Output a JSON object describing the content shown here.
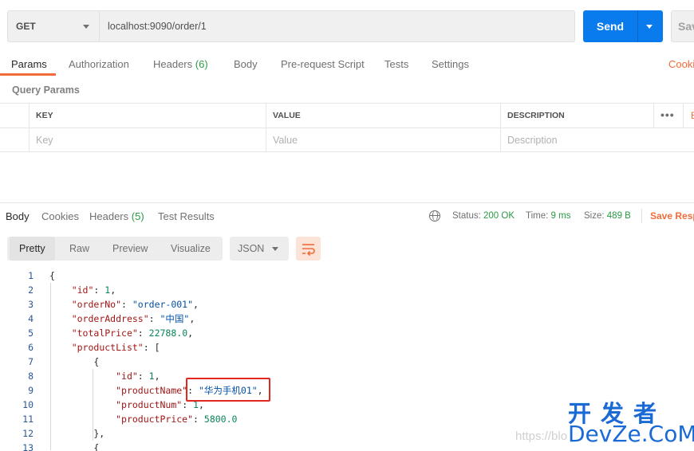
{
  "request": {
    "method": "GET",
    "url": "localhost:9090/order/1",
    "send_label": "Send",
    "save_label": "Sav"
  },
  "request_tabs": [
    {
      "label": "Params",
      "active": true
    },
    {
      "label": "Authorization"
    },
    {
      "label": "Headers",
      "count": "(6)"
    },
    {
      "label": "Body"
    },
    {
      "label": "Pre-request Script"
    },
    {
      "label": "Tests"
    },
    {
      "label": "Settings"
    }
  ],
  "cookies_link": "Cooki",
  "query_params": {
    "title": "Query Params",
    "headers": [
      "KEY",
      "VALUE",
      "DESCRIPTION"
    ],
    "placeholders": [
      "Key",
      "Value",
      "Description"
    ],
    "bulk_edit": "B"
  },
  "response_tabs": [
    {
      "label": "Body",
      "active": true
    },
    {
      "label": "Cookies"
    },
    {
      "label": "Headers",
      "count": "(5)"
    },
    {
      "label": "Test Results"
    }
  ],
  "response_status": {
    "status_label": "Status:",
    "status_value": "200 OK",
    "time_label": "Time:",
    "time_value": "9 ms",
    "size_label": "Size:",
    "size_value": "489 B",
    "save_response": "Save Resp"
  },
  "format_tabs": [
    "Pretty",
    "Raw",
    "Preview",
    "Visualize"
  ],
  "active_format": "Pretty",
  "language": "JSON",
  "code_lines": [
    {
      "n": "1",
      "text": "{"
    },
    {
      "n": "2",
      "text": "    \"id\": 1,"
    },
    {
      "n": "3",
      "text": "    \"orderNo\": \"order-001\","
    },
    {
      "n": "4",
      "text": "    \"orderAddress\": \"中国\","
    },
    {
      "n": "5",
      "text": "    \"totalPrice\": 22788.0,"
    },
    {
      "n": "6",
      "text": "    \"productList\": ["
    },
    {
      "n": "7",
      "text": "        {"
    },
    {
      "n": "8",
      "text": "            \"id\": 1,"
    },
    {
      "n": "9",
      "text": "            \"productName\": \"华为手机01\","
    },
    {
      "n": "10",
      "text": "            \"productNum\": 1,"
    },
    {
      "n": "11",
      "text": "            \"productPrice\": 5800.0"
    },
    {
      "n": "12",
      "text": "        },"
    },
    {
      "n": "13",
      "text": "        {"
    }
  ],
  "watermark": {
    "url": "https://blo",
    "logo_top": "开发者",
    "logo_bottom": "DevZe.CoM"
  },
  "colors": {
    "accent": "#f26b3a",
    "send": "#097bed",
    "success": "#2a9a45",
    "highlight_box": "#e2271f"
  }
}
